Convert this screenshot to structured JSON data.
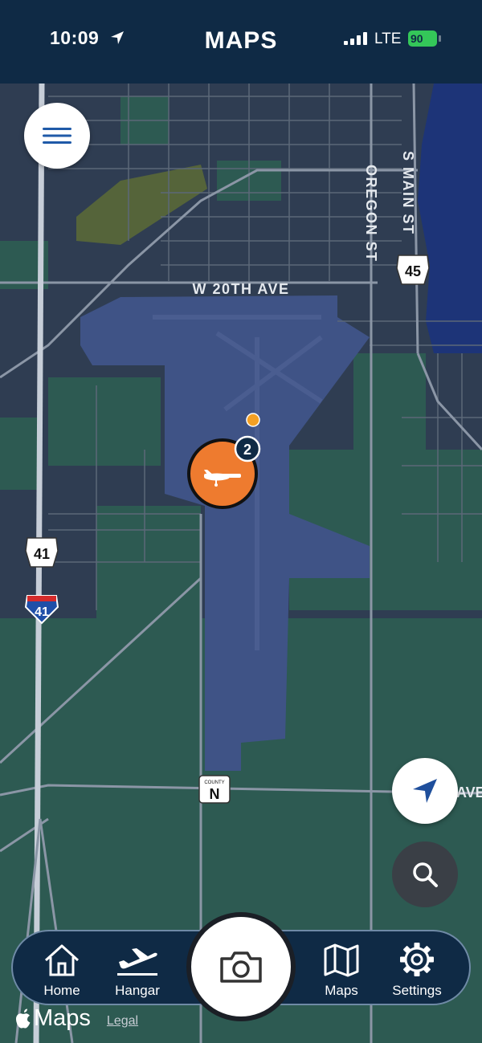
{
  "status_bar": {
    "time": "10:09",
    "carrier": "LTE",
    "battery": "90"
  },
  "header": {
    "title": "MAPS"
  },
  "map": {
    "street_labels": [
      "W 20TH AVE",
      "OREGON ST",
      "S MAIN ST",
      "AVE"
    ],
    "route_shields": [
      "45",
      "41",
      "41"
    ],
    "county_shield": {
      "caption": "COUNTY",
      "letter": "N"
    },
    "aircraft_marker": {
      "badge_count": "2",
      "icon": "airplane-icon"
    }
  },
  "controls": {
    "menu": "hamburger-menu-icon",
    "locate": "location-arrow-icon",
    "search": "magnifier-icon",
    "camera": "camera-icon"
  },
  "tabs": [
    {
      "label": "Home",
      "icon": "house-icon"
    },
    {
      "label": "Hangar",
      "icon": "airplane-takeoff-icon"
    },
    {
      "label": "Maps",
      "icon": "folded-map-icon"
    },
    {
      "label": "Settings",
      "icon": "gear-icon"
    }
  ],
  "attribution": {
    "brand": "Maps",
    "legal": "Legal"
  },
  "colors": {
    "header": "#0f2a45",
    "marker": "#ee7b2f",
    "airport_area": "#3f5386",
    "water": "#1d3478",
    "green_area": "#2d5a52",
    "battery": "#34c759"
  }
}
